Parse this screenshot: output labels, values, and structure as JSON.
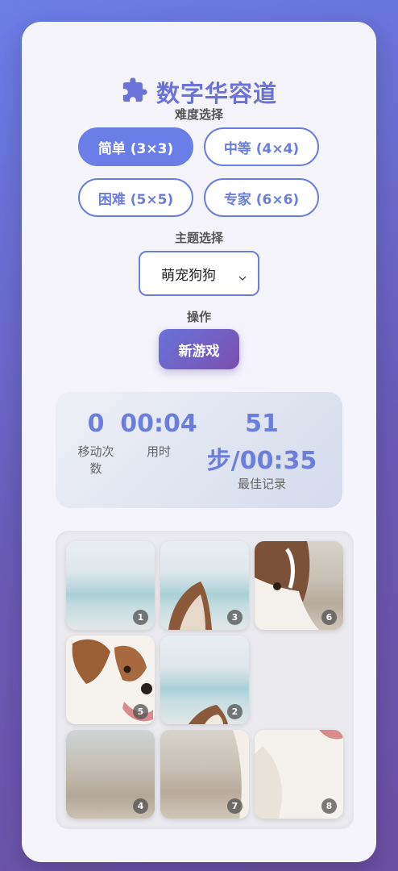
{
  "title": "数字华容道",
  "difficulty": {
    "label": "难度选择",
    "options": [
      "简单 (3×3)",
      "中等 (4×4)",
      "困难 (5×5)",
      "专家 (6×6)"
    ],
    "selected_index": 0
  },
  "theme": {
    "label": "主题选择",
    "selected": "萌宠狗狗"
  },
  "actions": {
    "label": "操作",
    "new_game": "新游戏"
  },
  "stats": {
    "moves_value": "0",
    "moves_label": "移动次数",
    "time_value": "00:04",
    "time_label": "用时",
    "best_value_line1": "51",
    "best_value_line2": "步/00:35",
    "best_label": "最佳记录"
  },
  "board": {
    "size": 3,
    "tiles": [
      1,
      3,
      6,
      5,
      2,
      null,
      4,
      7,
      8
    ]
  },
  "colors": {
    "accent": "#6a7ee0",
    "accent_dark": "#7a4fb0",
    "card_bg": "#f5f4fa"
  },
  "icons": {
    "title_icon": "puzzle-piece-icon",
    "select_icon": "chevron-down-icon"
  }
}
